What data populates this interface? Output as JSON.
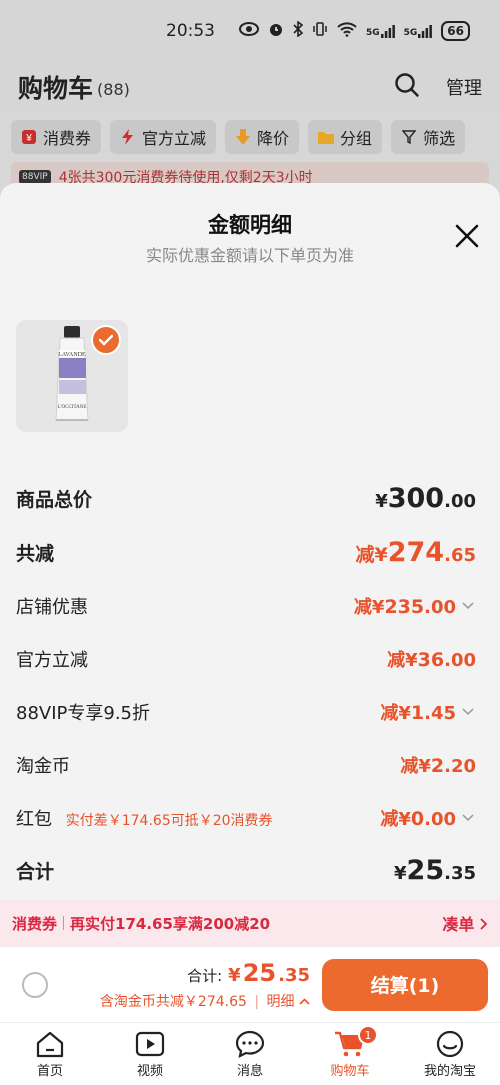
{
  "status_bar": {
    "time": "20:53",
    "battery": "66",
    "signal_5g_1": "5G",
    "signal_5g_2": "5G"
  },
  "cart": {
    "title": "购物车",
    "count": "(88)",
    "manage_label": "管理"
  },
  "filters": [
    {
      "label": "消费券",
      "icon": "coupon-icon"
    },
    {
      "label": "官方立减",
      "icon": "lightning-icon"
    },
    {
      "label": "降价",
      "icon": "down-arrow-icon"
    },
    {
      "label": "分组",
      "icon": "folder-icon"
    },
    {
      "label": "筛选",
      "icon": "filter-icon"
    }
  ],
  "promo_banner": {
    "badge": "88VIP",
    "text": "4张共300元消费券待使用,仅剩2天3小时"
  },
  "sheet": {
    "title": "金额明细",
    "subtitle": "实际优惠金额请以下单页为准",
    "product_image_alt": "L'OCCITANE LAVANDE hand cream tube"
  },
  "breakdown": {
    "total_price": {
      "label": "商品总价",
      "currency": "¥",
      "int": "300",
      "dec": ".00"
    },
    "total_discount": {
      "label": "共减",
      "prefix": "减¥",
      "int": "274",
      "dec": ".65"
    },
    "store_discount": {
      "label": "店铺优惠",
      "prefix": "减¥",
      "int": "235",
      "dec": ".00"
    },
    "official_discount": {
      "label": "官方立减",
      "prefix": "减¥",
      "int": "36",
      "dec": ".00"
    },
    "vip_discount": {
      "label": "88VIP专享9.5折",
      "prefix": "减¥",
      "int": "1",
      "dec": ".45"
    },
    "taojinbi": {
      "label": "淘金币",
      "prefix": "减¥",
      "int": "2",
      "dec": ".20"
    },
    "red_packet": {
      "label": "红包",
      "note": "实付差￥174.65可抵￥20消费券",
      "prefix": "减¥",
      "int": "0",
      "dec": ".00"
    },
    "subtotal": {
      "label": "合计",
      "currency": "¥",
      "int": "25",
      "dec": ".35"
    }
  },
  "coupon_strip": {
    "tag": "消费券",
    "text": "再实付174.65享满200减20",
    "action": "凑单"
  },
  "checkout": {
    "total_label": "合计:",
    "currency": "¥",
    "total_int": "25",
    "total_dec": ".35",
    "savings_text": "含淘金币共减￥274.65",
    "detail_label": "明细",
    "pay_button": "结算(1)"
  },
  "tabbar": [
    {
      "label": "首页",
      "icon": "home-icon"
    },
    {
      "label": "视频",
      "icon": "video-icon"
    },
    {
      "label": "消息",
      "icon": "message-icon"
    },
    {
      "label": "购物车",
      "icon": "cart-icon",
      "badge": "1",
      "active": true
    },
    {
      "label": "我的淘宝",
      "icon": "profile-icon"
    }
  ],
  "colors": {
    "accent": "#e8532c",
    "pay_button": "#ed6a2e",
    "coupon_red": "#d9283f"
  }
}
